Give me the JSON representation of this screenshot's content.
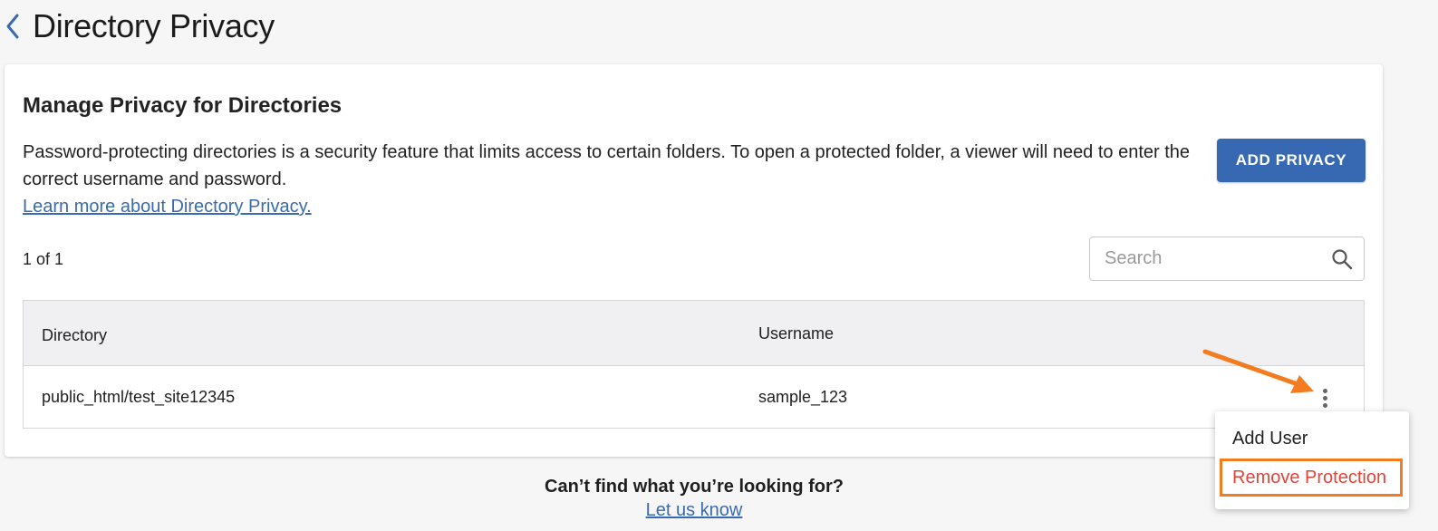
{
  "header": {
    "title": "Directory Privacy",
    "back_icon": "chevron-left-icon"
  },
  "card": {
    "title": "Manage Privacy for Directories",
    "description": "Password-protecting directories is a security feature that limits access to certain folders. To open a protected folder, a viewer will need to enter the correct username and password.",
    "learn_more_link": "Learn more about Directory Privacy.",
    "add_button_label": "ADD PRIVACY",
    "count_label": "1 of 1",
    "search": {
      "placeholder": "Search",
      "value": "",
      "icon": "search-icon"
    }
  },
  "table": {
    "columns": [
      "Directory",
      "Username"
    ],
    "rows": [
      {
        "directory": "public_html/test_site12345",
        "username": "sample_123"
      }
    ],
    "row_actions_icon": "kebab-menu-icon"
  },
  "actions_menu": {
    "items": [
      "Add User",
      "Remove Protection"
    ],
    "highlighted_item": "Remove Protection"
  },
  "annotation": {
    "arrow_color": "#f47c20",
    "highlight_color": "#f47c20"
  },
  "footer": {
    "question": "Can’t find what you’re looking for?",
    "link": "Let us know"
  },
  "colors": {
    "primary": "#3769b3",
    "link": "#3a6ab0",
    "danger": "#e14438",
    "background": "#f6f6f7"
  }
}
